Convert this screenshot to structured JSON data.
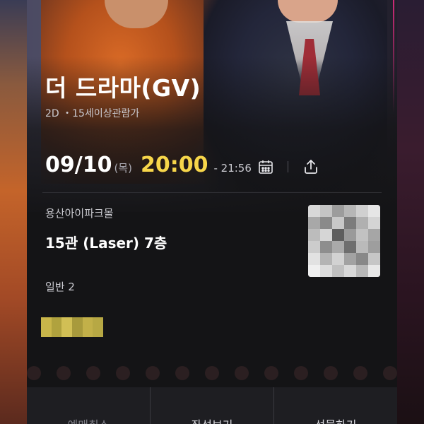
{
  "movie": {
    "title": "더 드라마(GV)",
    "info": "2D ・15세이상관람가"
  },
  "showtime": {
    "date": "09/10",
    "day_of_week": "(목)",
    "start_time": "20:00",
    "end_time": "- 21:56"
  },
  "icons": {
    "calendar": "calendar-icon",
    "share": "share-icon"
  },
  "venue": {
    "theater": "용산아이파크몰",
    "screen": "15관 (Laser) 7층"
  },
  "tickets": {
    "people": "일반 2"
  },
  "actions": {
    "cancel_label": "예매취소",
    "seat_label": "좌석보기",
    "gift_label": "선물하기"
  },
  "colors": {
    "accent_time": "#f7d64a",
    "poster_orange": "#c4642a",
    "poster_pink_line": "#d02a78",
    "background": "#141416"
  }
}
